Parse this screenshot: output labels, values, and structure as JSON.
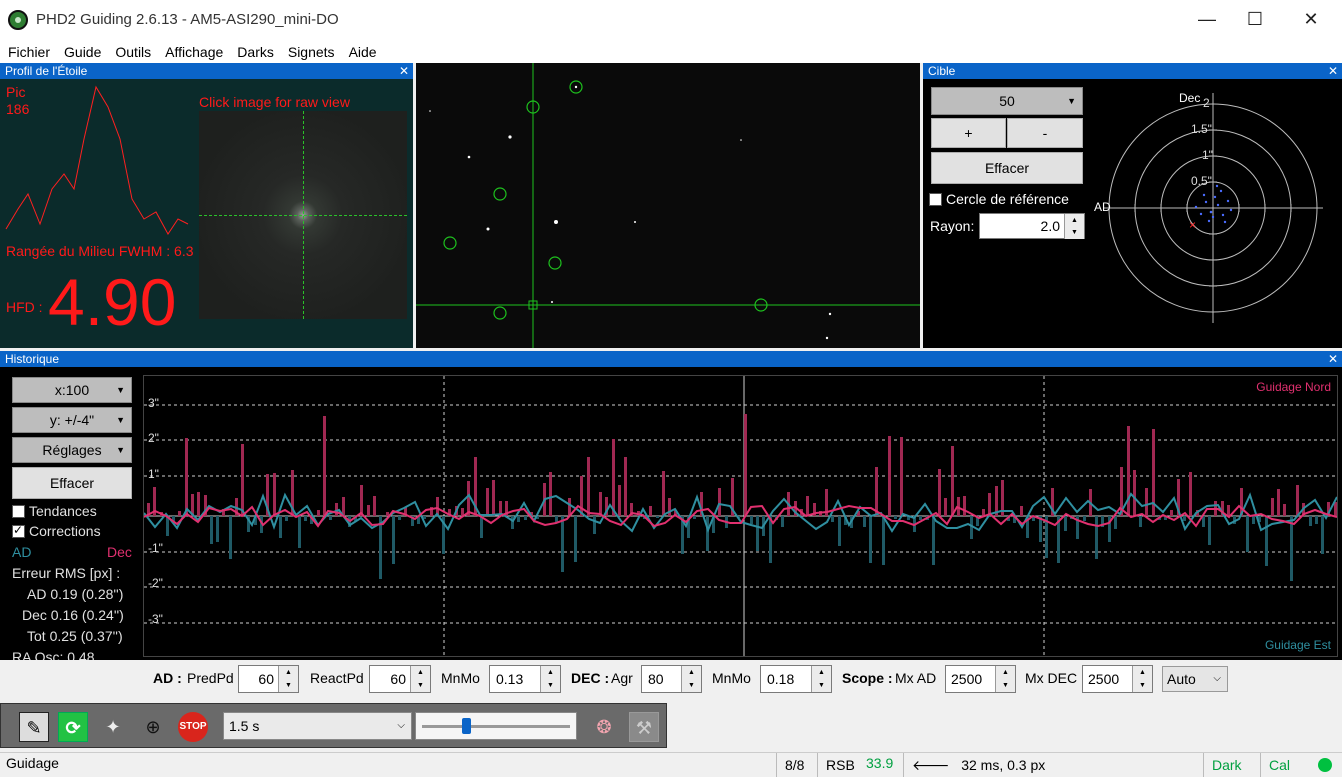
{
  "window": {
    "title": "PHD2 Guiding 2.6.13 - AM5-ASI290_mini-DO",
    "min": "—",
    "max": "☐",
    "close": "✕"
  },
  "menu": [
    "Fichier",
    "Guide",
    "Outils",
    "Affichage",
    "Darks",
    "Signets",
    "Aide"
  ],
  "profile": {
    "title": "Profil de l'Étoile",
    "peak_label": "Pic",
    "peak_value": "186",
    "hint": "Click image for raw view",
    "fwhm": "Rangée du Milieu FWHM : 6.3",
    "hfd_label": "HFD :",
    "hfd_value": "4.90"
  },
  "target": {
    "title": "Cible",
    "scale": "50",
    "plus": "+",
    "minus": "-",
    "clear": "Effacer",
    "ref_circle": "Cercle de référence",
    "radius_label": "Rayon:",
    "radius_value": "2.0",
    "dec_label": "Dec",
    "ra_label": "AD",
    "rings": [
      "2",
      "1.5\"",
      "1\"",
      "0.5\""
    ]
  },
  "history": {
    "title": "Historique",
    "x_scale": "x:100",
    "y_scale": "y: +/-4\"",
    "settings": "Réglages",
    "clear": "Effacer",
    "trends": "Tendances",
    "corrections": "Corrections",
    "ra_label": "AD",
    "dec_label": "Dec",
    "rms_title": "Erreur RMS [px] :",
    "rms_ra": "AD 0.19 (0.28'')",
    "rms_dec": "Dec 0.16 (0.24'')",
    "rms_tot": "Tot 0.25 (0.37'')",
    "ra_osc": "RA Osc: 0.48",
    "north": "Guidage Nord",
    "east": "Guidage Est",
    "y_ticks": [
      "3\"",
      "2\"",
      "1\"",
      "-1\"",
      "-2\"",
      "-3\""
    ]
  },
  "params": {
    "ad_label": "AD :",
    "predpd_label": "PredPd",
    "predpd": "60",
    "reactpd_label": "ReactPd",
    "reactpd": "60",
    "mnmo_label": "MnMo",
    "mnmo_ra": "0.13",
    "dec_label": "DEC :",
    "agr_label": "Agr",
    "agr": "80",
    "mnmo_dec": "0.18",
    "scope_label": "Scope :",
    "mxad_label": "Mx AD",
    "mxad": "2500",
    "mxdec_label": "Mx DEC",
    "mxdec": "2500",
    "mode": "Auto"
  },
  "toolbar": {
    "exposure": "1.5 s",
    "slider_fraction": 0.3
  },
  "status": {
    "mode": "Guidage",
    "frames": "8/8",
    "snr_label": "RSB",
    "snr": "33.9",
    "pulse": "32 ms, 0.3 px",
    "dark": "Dark",
    "cal": "Cal"
  },
  "colors": {
    "ra": "#2f8fa0",
    "dec": "#e0306f",
    "accent": "#0a64c8",
    "ok": "#00b050"
  }
}
